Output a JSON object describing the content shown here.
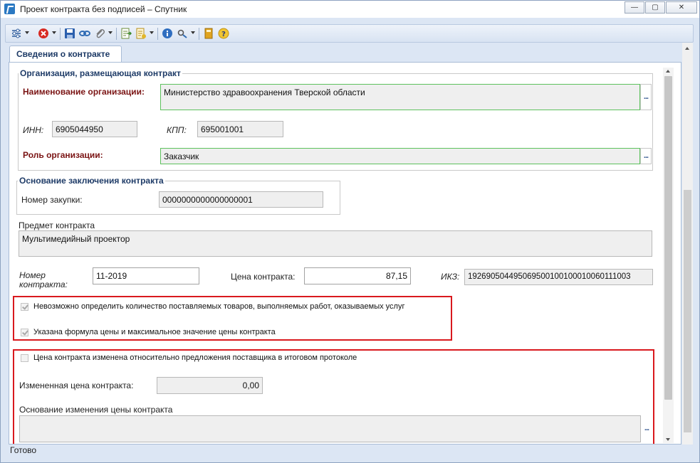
{
  "window": {
    "title": "Проект контракта без подписей – Спутник",
    "buttons": {
      "minimize": "—",
      "restore": "▢",
      "close": "✕"
    }
  },
  "toolbar": {
    "items": [
      "settings-icon",
      "delete-icon",
      "save-icon",
      "link-icon",
      "attach-icon",
      "export-icon",
      "report-icon",
      "info-icon",
      "tools-icon",
      "book-icon",
      "help-icon"
    ]
  },
  "tabs": [
    {
      "label": "Сведения о контракте",
      "active": true
    }
  ],
  "org_section": {
    "title": "Организация, размещающая контракт",
    "name_label": "Наименование организации:",
    "name_value": "Министерство здравоохранения Тверской области",
    "inn_label": "ИНН:",
    "inn_value": "6905044950",
    "kpp_label": "КПП:",
    "kpp_value": "695001001",
    "role_label": "Роль организации:",
    "role_value": "Заказчик",
    "ellipsis": "..."
  },
  "basis_section": {
    "title": "Основание заключения контракта",
    "purchase_label": "Номер закупки:",
    "purchase_value": "0000000000000000001"
  },
  "subject": {
    "label": "Предмет контракта",
    "value": "Мультимедийный проектор"
  },
  "contract": {
    "number_label": "Номер контракта:",
    "number_value": "11-2019",
    "price_label": "Цена контракта:",
    "price_value": "87,15",
    "ikz_label": "ИКЗ:",
    "ikz_value": "192690504495069500100100010060111003"
  },
  "checkboxes_group1": [
    {
      "label": "Невозможно определить количество поставляемых товаров, выполняемых работ, оказываемых услуг",
      "checked": true
    },
    {
      "label": "Указана формула цены и максимальное значение цены контракта",
      "checked": true
    }
  ],
  "price_change": {
    "checkbox_label": "Цена контракта изменена относительно предложения поставщика в итоговом протоколе",
    "checked": false,
    "changed_price_label": "Измененная цена контракта:",
    "changed_price_value": "0,00",
    "reason_label": "Основание изменения цены контракта",
    "reason_value": "",
    "ellipsis": "..."
  },
  "status": {
    "text": "Готово"
  },
  "colors": {
    "highlight": "#d9191e",
    "required_label": "#7a1313",
    "section_title": "#1f3c68",
    "valid_border": "#5dc15d"
  }
}
